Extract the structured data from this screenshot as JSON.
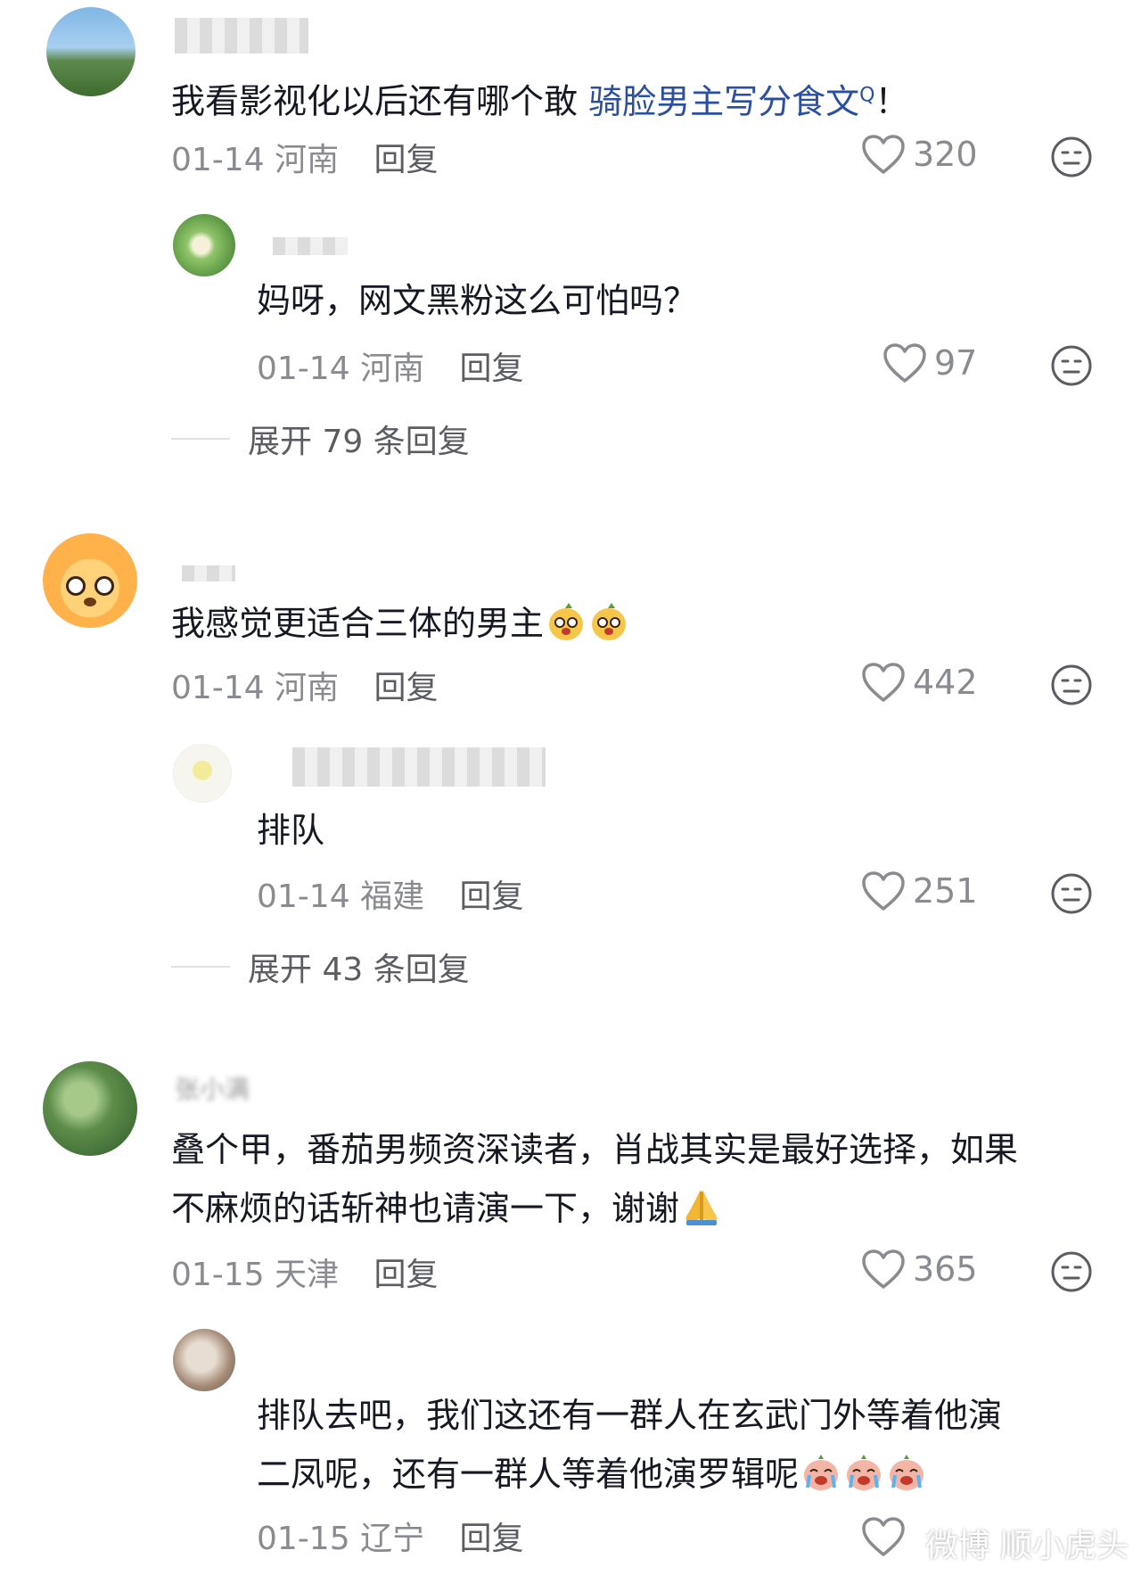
{
  "comments": [
    {
      "text_prefix": "我看影视化以后还有哪个敢 ",
      "text_link": "骑脸男主写分食文",
      "text_link_mark": "Q",
      "text_suffix": "！",
      "date": "01-14",
      "location": "河南",
      "reply_label": "回复",
      "likes": "320"
    },
    {
      "text": "妈呀，网文黑粉这么可怕吗？",
      "date": "01-14",
      "location": "河南",
      "reply_label": "回复",
      "likes": "97"
    },
    {
      "text": "我感觉更适合三体的男主",
      "date": "01-14",
      "location": "河南",
      "reply_label": "回复",
      "likes": "442"
    },
    {
      "text": "排队",
      "date": "01-14",
      "location": "福建",
      "reply_label": "回复",
      "likes": "251"
    },
    {
      "username": "张小满",
      "text_line1": "叠个甲，番茄男频资深读者，肖战其实是最好选择，如果",
      "text_line2": "不麻烦的话斩神也请演一下，谢谢",
      "date": "01-15",
      "location": "天津",
      "reply_label": "回复",
      "likes": "365"
    },
    {
      "text_line1": "排队去吧，我们这还有一群人在玄武门外等着他演",
      "text_line2": "二凤呢，还有一群人等着他演罗辑呢",
      "date": "01-15",
      "location": "辽宁",
      "reply_label": "回复"
    }
  ],
  "expand": [
    {
      "label": "展开 79 条回复"
    },
    {
      "label": "展开 43 条回复"
    }
  ],
  "watermark": "微博 顺小虎头",
  "icons": {
    "like": "heart-icon",
    "dislike": "neutral-face-icon",
    "emoji_mango": "mango-emoji-icon",
    "emoji_pray": "folded-hands-emoji-icon",
    "emoji_cry": "crying-emoji-icon"
  },
  "colors": {
    "text": "#161823",
    "meta": "#8a8b91",
    "link": "#2b4fa0"
  }
}
